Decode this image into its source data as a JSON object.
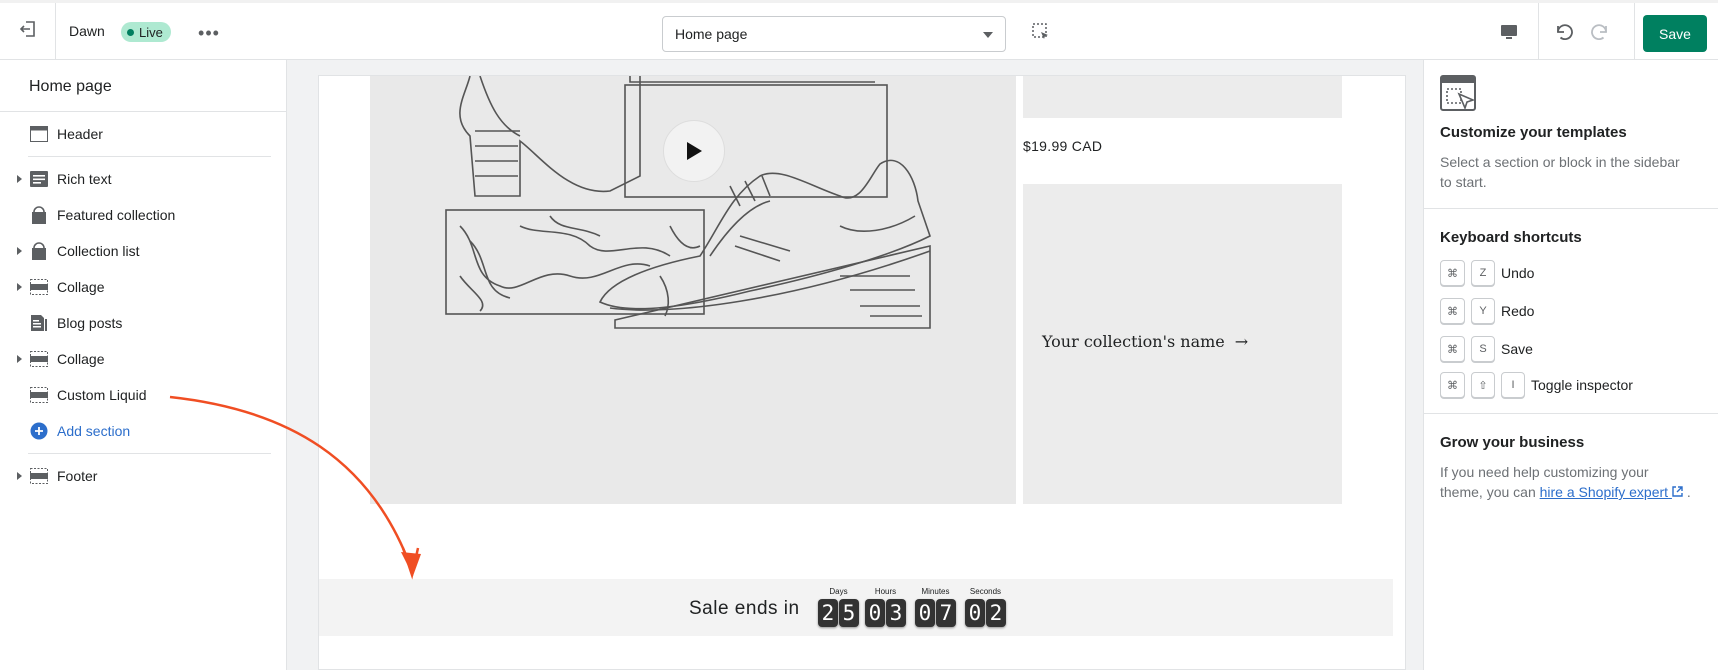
{
  "topbar": {
    "theme_name": "Dawn",
    "live_badge": "Live",
    "more_label": "•••",
    "template_select": "Home page",
    "save_label": "Save"
  },
  "sidebar": {
    "title": "Home page",
    "items": [
      {
        "label": "Header",
        "icon": "header-icon",
        "expandable": false
      },
      {
        "label": "Rich text",
        "icon": "text-icon",
        "expandable": true
      },
      {
        "label": "Featured collection",
        "icon": "tag-icon",
        "expandable": false
      },
      {
        "label": "Collection list",
        "icon": "tag-icon",
        "expandable": true
      },
      {
        "label": "Collage",
        "icon": "section-icon",
        "expandable": true
      },
      {
        "label": "Blog posts",
        "icon": "blog-icon",
        "expandable": false
      },
      {
        "label": "Collage",
        "icon": "section-icon",
        "expandable": true
      },
      {
        "label": "Custom Liquid",
        "icon": "section-icon",
        "expandable": false
      }
    ],
    "add_section": "Add section",
    "footer": {
      "label": "Footer",
      "icon": "footer-icon",
      "expandable": true
    }
  },
  "preview": {
    "price": "$19.99 CAD",
    "collection_name": "Your collection's name",
    "collection_arrow": "→",
    "sale_text": "Sale ends in",
    "countdown": [
      {
        "label": "Days",
        "digits": [
          "2",
          "5"
        ]
      },
      {
        "label": "Hours",
        "digits": [
          "0",
          "3"
        ]
      },
      {
        "label": "Minutes",
        "digits": [
          "0",
          "7"
        ]
      },
      {
        "label": "Seconds",
        "digits": [
          "0",
          "2"
        ]
      }
    ]
  },
  "right_panel": {
    "customize_title": "Customize your templates",
    "customize_text": "Select a section or block in the sidebar to start.",
    "shortcuts_title": "Keyboard shortcuts",
    "shortcuts": [
      {
        "keys": [
          "⌘",
          "Z"
        ],
        "label": "Undo"
      },
      {
        "keys": [
          "⌘",
          "Y"
        ],
        "label": "Redo"
      },
      {
        "keys": [
          "⌘",
          "S"
        ],
        "label": "Save"
      },
      {
        "keys": [
          "⌘",
          "⇧",
          "I"
        ],
        "label": "Toggle inspector"
      }
    ],
    "grow_title": "Grow your business",
    "grow_text_before": "If you need help customizing your theme, you can",
    "grow_link": "hire a Shopify expert",
    "grow_text_after": "."
  },
  "colors": {
    "accent": "#008060",
    "link": "#2c6ecb",
    "live_badge": "#aee9d1",
    "annotation_arrow": "#f04e23"
  }
}
